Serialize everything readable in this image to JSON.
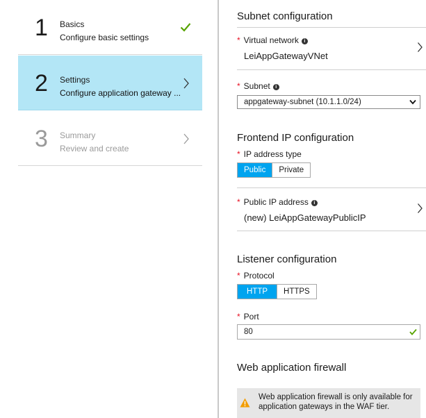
{
  "steps": [
    {
      "number": "1",
      "title": "Basics",
      "subtitle": "Configure basic settings",
      "status": "complete"
    },
    {
      "number": "2",
      "title": "Settings",
      "subtitle": "Configure application gateway ...",
      "status": "active"
    },
    {
      "number": "3",
      "title": "Summary",
      "subtitle": "Review and create",
      "status": "disabled"
    }
  ],
  "subnet_config": {
    "title": "Subnet configuration",
    "virtual_network_label": "Virtual network",
    "virtual_network_value": "LeiAppGatewayVNet",
    "subnet_label": "Subnet",
    "subnet_value": "appgateway-subnet (10.1.1.0/24)"
  },
  "frontend_ip": {
    "title": "Frontend IP configuration",
    "ip_type_label": "IP address type",
    "ip_type_options": [
      "Public",
      "Private"
    ],
    "ip_type_selected": "Public",
    "public_ip_label": "Public IP address",
    "public_ip_value": "(new) LeiAppGatewayPublicIP"
  },
  "listener": {
    "title": "Listener configuration",
    "protocol_label": "Protocol",
    "protocol_options": [
      "HTTP",
      "HTTPS"
    ],
    "protocol_selected": "HTTP",
    "port_label": "Port",
    "port_value": "80"
  },
  "waf": {
    "title": "Web application firewall",
    "warning_text": "Web application firewall is only available for application gateways in the WAF tier."
  },
  "colors": {
    "accent": "#00a4ef",
    "active_step_bg": "#b3e6f6",
    "required": "#e81123",
    "success": "#57a300",
    "warning": "#f29d00"
  },
  "info_glyph": "i"
}
